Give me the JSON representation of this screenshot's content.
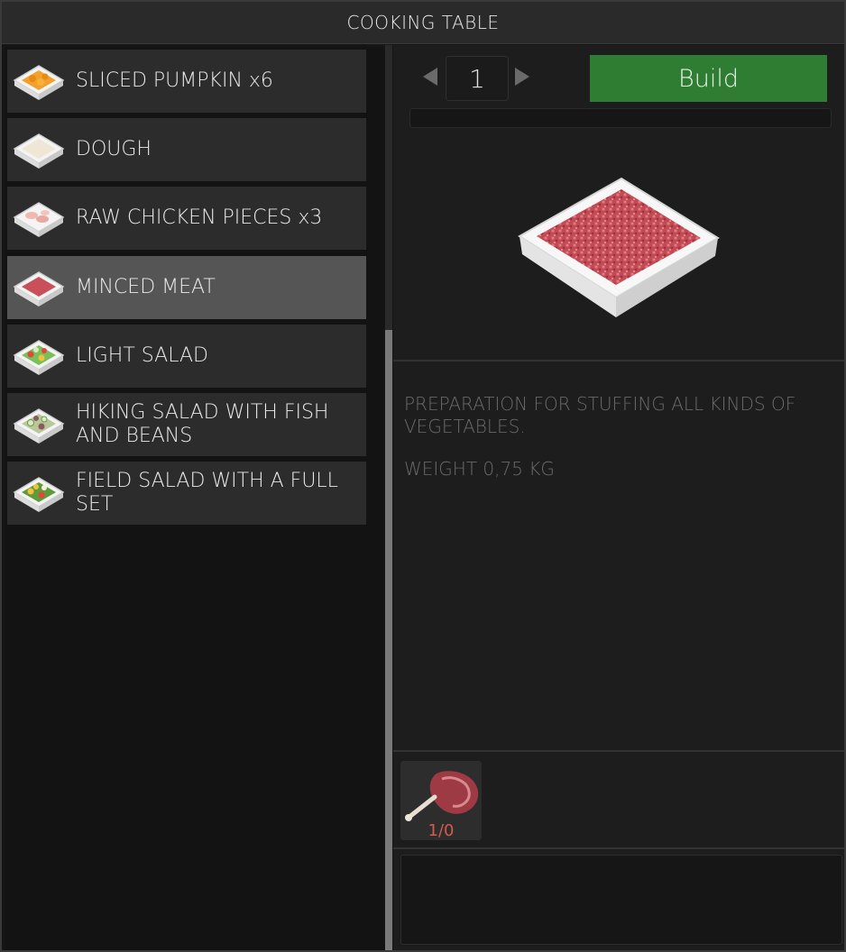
{
  "window": {
    "title": "COOKING TABLE"
  },
  "recipes": [
    {
      "label": "SLICED PUMPKIN x6",
      "icon": "pumpkin-tray-icon",
      "selected": false
    },
    {
      "label": "DOUGH",
      "icon": "dough-tray-icon",
      "selected": false
    },
    {
      "label": "RAW CHICKEN PIECES x3",
      "icon": "chicken-tray-icon",
      "selected": false
    },
    {
      "label": "MINCED MEAT",
      "icon": "minced-meat-tray-icon",
      "selected": true
    },
    {
      "label": "LIGHT SALAD",
      "icon": "light-salad-tray-icon",
      "selected": false
    },
    {
      "label": "HIKING SALAD WITH FISH AND BEANS",
      "icon": "hiking-salad-tray-icon",
      "selected": false
    },
    {
      "label": "FIELD SALAD WITH A FULL SET",
      "icon": "field-salad-tray-icon",
      "selected": false
    }
  ],
  "craft": {
    "quantity": "1",
    "build_label": "Build",
    "progress": 0
  },
  "detail": {
    "preview_icon": "minced-meat-tray-icon",
    "description": "PREPARATION FOR STUFFING ALL KINDS OF VEGETABLES.",
    "weight": "WEIGHT 0,75 KG"
  },
  "ingredients": [
    {
      "icon": "raw-meat-icon",
      "count": "1/0"
    }
  ],
  "colors": {
    "build_green": "#2e7d32",
    "selected_row": "#555555",
    "row": "#2c2c2c",
    "missing_red": "#d65a4a"
  }
}
